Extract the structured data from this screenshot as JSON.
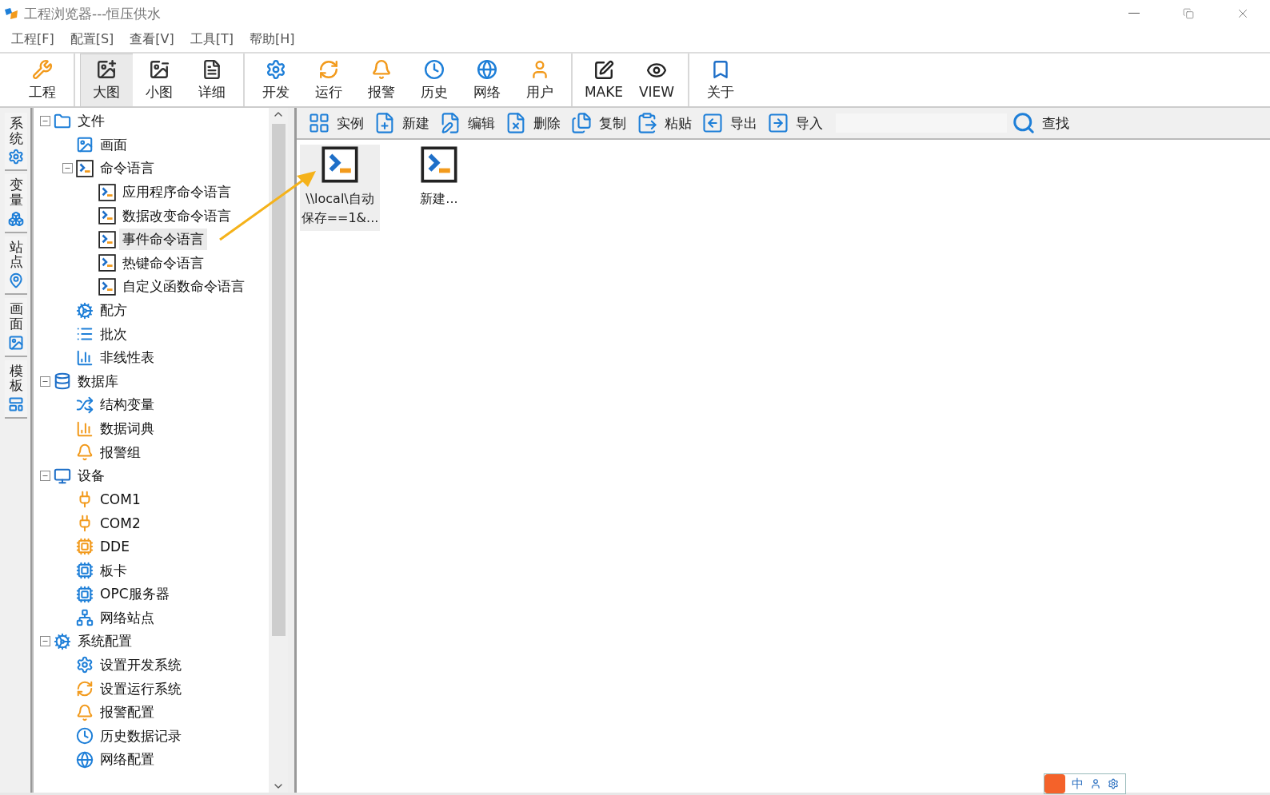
{
  "window": {
    "title": "工程浏览器---恒压供水"
  },
  "menu": [
    "工程[F]",
    "配置[S]",
    "查看[V]",
    "工具[T]",
    "帮助[H]"
  ],
  "toolbar": {
    "groups": [
      [
        {
          "label": "工程",
          "selected": false
        }
      ],
      [
        {
          "label": "大图",
          "selected": true
        },
        {
          "label": "小图",
          "selected": false
        },
        {
          "label": "详细",
          "selected": false
        }
      ],
      [
        {
          "label": "开发",
          "selected": false
        },
        {
          "label": "运行",
          "selected": false
        },
        {
          "label": "报警",
          "selected": false
        },
        {
          "label": "历史",
          "selected": false
        },
        {
          "label": "网络",
          "selected": false
        },
        {
          "label": "用户",
          "selected": false
        }
      ],
      [
        {
          "label": "MAKE",
          "selected": false
        },
        {
          "label": "VIEW",
          "selected": false
        }
      ],
      [
        {
          "label": "关于",
          "selected": false
        }
      ]
    ]
  },
  "side_tabs": [
    "系统",
    "变量",
    "站点",
    "画面",
    "模板"
  ],
  "tree": [
    {
      "label": "文件",
      "expanded": true,
      "selected": false,
      "children": [
        {
          "label": "画面",
          "selected": false
        },
        {
          "label": "命令语言",
          "expanded": true,
          "selected": false,
          "children": [
            {
              "label": "应用程序命令语言",
              "selected": false
            },
            {
              "label": "数据改变命令语言",
              "selected": false
            },
            {
              "label": "事件命令语言",
              "selected": true
            },
            {
              "label": "热键命令语言",
              "selected": false
            },
            {
              "label": "自定义函数命令语言",
              "selected": false
            }
          ]
        },
        {
          "label": "配方",
          "selected": false
        },
        {
          "label": "批次",
          "selected": false
        },
        {
          "label": "非线性表",
          "selected": false
        }
      ]
    },
    {
      "label": "数据库",
      "expanded": true,
      "selected": false,
      "children": [
        {
          "label": "结构变量",
          "selected": false
        },
        {
          "label": "数据词典",
          "selected": false
        },
        {
          "label": "报警组",
          "selected": false
        }
      ]
    },
    {
      "label": "设备",
      "expanded": true,
      "selected": false,
      "children": [
        {
          "label": "COM1",
          "selected": false
        },
        {
          "label": "COM2",
          "selected": false
        },
        {
          "label": "DDE",
          "selected": false
        },
        {
          "label": "板卡",
          "selected": false
        },
        {
          "label": "OPC服务器",
          "selected": false
        },
        {
          "label": "网络站点",
          "selected": false
        }
      ]
    },
    {
      "label": "系统配置",
      "expanded": true,
      "selected": false,
      "children": [
        {
          "label": "设置开发系统",
          "selected": false
        },
        {
          "label": "设置运行系统",
          "selected": false
        },
        {
          "label": "报警配置",
          "selected": false
        },
        {
          "label": "历史数据记录",
          "selected": false
        },
        {
          "label": "网络配置",
          "selected": false
        }
      ]
    }
  ],
  "content_toolbar": {
    "buttons": [
      "实例",
      "新建",
      "编辑",
      "删除",
      "复制",
      "粘贴",
      "导出",
      "导入"
    ],
    "find": "查找"
  },
  "items": [
    {
      "label": "\\\\local\\自动保存==1&...",
      "selected": true
    },
    {
      "label": "新建...",
      "selected": false
    }
  ],
  "ime": {
    "label": "中"
  }
}
